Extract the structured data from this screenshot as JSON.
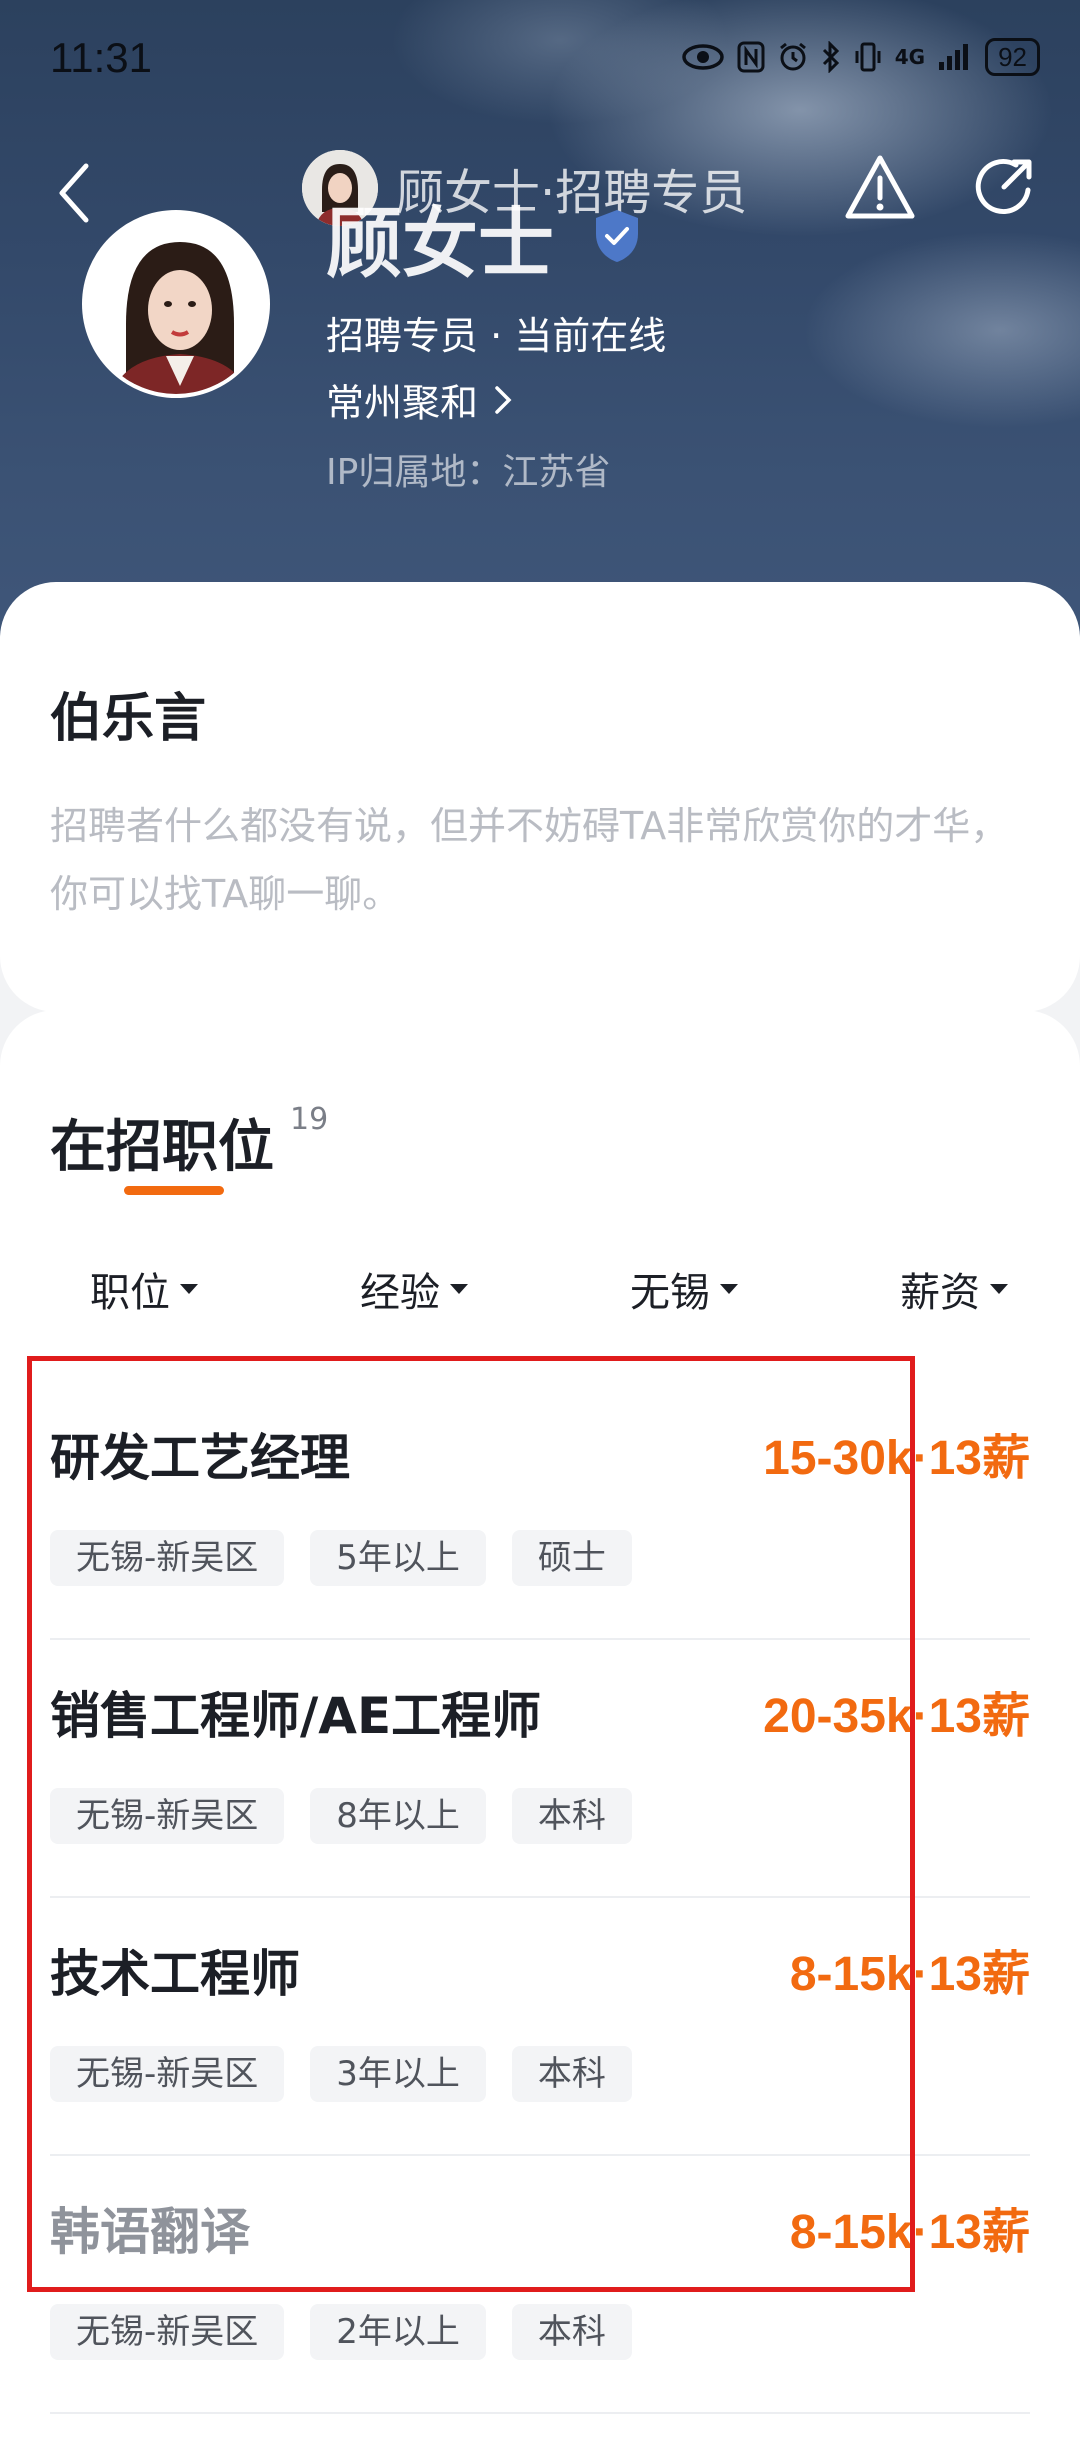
{
  "status_bar": {
    "time": "11:31",
    "network": "4G",
    "battery": "92"
  },
  "navbar": {
    "mini_title": "顾女士·招聘专员",
    "back_icon": "back-chevron-icon",
    "warning_icon": "warning-icon",
    "share_icon": "share-icon"
  },
  "profile": {
    "name": "顾女士",
    "role_status": "招聘专员 · 当前在线",
    "company": "常州聚和",
    "ip_location": "IP归属地：江苏省"
  },
  "intro": {
    "title": "伯乐言",
    "text": "招聘者什么都没有说，但并不妨碍TA非常欣赏你的才华，你可以找TA聊一聊。"
  },
  "jobs": {
    "title": "在招职位",
    "count": "19",
    "filters": [
      "职位",
      "经验",
      "无锡",
      "薪资"
    ],
    "items": [
      {
        "title": "研发工艺经理",
        "salary": "15-30k·13薪",
        "tags": [
          "无锡-新吴区",
          "5年以上",
          "硕士"
        ]
      },
      {
        "title": "销售工程师/AE工程师",
        "salary": "20-35k·13薪",
        "tags": [
          "无锡-新吴区",
          "8年以上",
          "本科"
        ]
      },
      {
        "title": "技术工程师",
        "salary": "8-15k·13薪",
        "tags": [
          "无锡-新吴区",
          "3年以上",
          "本科"
        ]
      },
      {
        "title": "韩语翻译",
        "salary": "8-15k·13薪",
        "tags": [
          "无锡-新吴区",
          "2年以上",
          "本科"
        ]
      }
    ]
  },
  "colors": {
    "accent": "#f26a10",
    "highlight_box": "#e01c1c",
    "hero_bg": "#33496a"
  }
}
